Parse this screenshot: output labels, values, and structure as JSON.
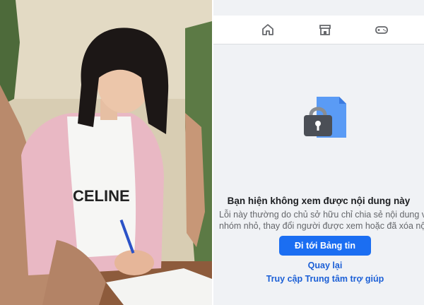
{
  "photo": {
    "shirt_text": "CELINE",
    "alt": "photo-left-panel"
  },
  "nav": {
    "icons": [
      "home-icon",
      "marketplace-icon",
      "gaming-icon"
    ]
  },
  "error": {
    "title": "Bạn hiện không xem được nội dung này",
    "body_line1": "Lỗi này thường do chủ sở hữu chỉ chia sẻ nội dung với một",
    "body_line2": "nhóm nhỏ, thay đổi người được xem hoặc đã xóa nội dung.",
    "primary_button": "Đi tới Bảng tin",
    "back_link": "Quay lại",
    "help_link": "Truy cập Trung tâm trợ giúp"
  },
  "colors": {
    "accent": "#1b6ef2",
    "link": "#1b5fd6",
    "background": "#f0f2f5"
  }
}
